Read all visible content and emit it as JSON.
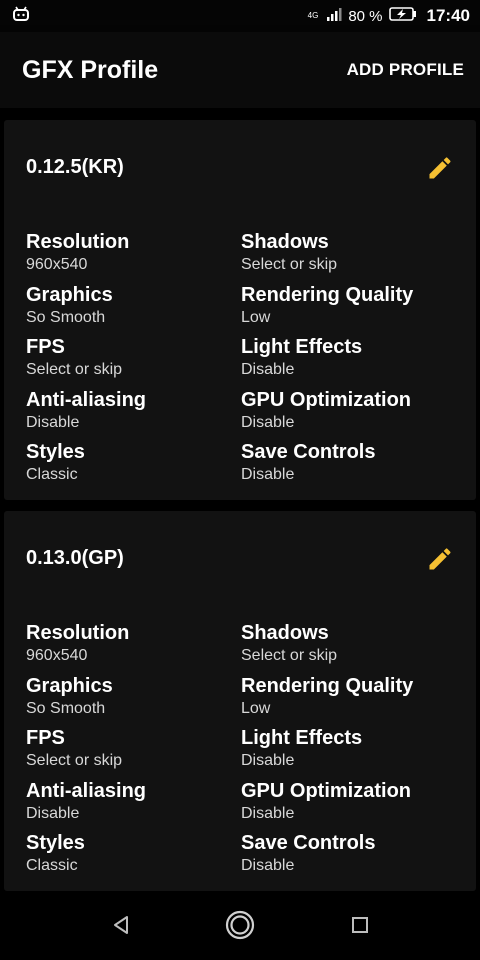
{
  "status_bar": {
    "network": "4G",
    "battery": "80 %",
    "time": "17:40"
  },
  "app_bar": {
    "title": "GFX Profile",
    "action": "ADD PROFILE"
  },
  "colors": {
    "accent": "#f5c032",
    "background": "#000000",
    "card": "#121212"
  },
  "profiles": [
    {
      "name": "0.12.5(KR)",
      "settings": [
        {
          "label": "Resolution",
          "value": "960x540"
        },
        {
          "label": "Shadows",
          "value": "Select or skip"
        },
        {
          "label": "Graphics",
          "value": "So Smooth"
        },
        {
          "label": "Rendering Quality",
          "value": "Low"
        },
        {
          "label": "FPS",
          "value": "Select or skip"
        },
        {
          "label": "Light Effects",
          "value": "Disable"
        },
        {
          "label": "Anti-aliasing",
          "value": "Disable"
        },
        {
          "label": "GPU Optimization",
          "value": "Disable"
        },
        {
          "label": "Styles",
          "value": "Classic"
        },
        {
          "label": "Save Controls",
          "value": "Disable"
        }
      ]
    },
    {
      "name": "0.13.0(GP)",
      "settings": [
        {
          "label": "Resolution",
          "value": "960x540"
        },
        {
          "label": "Shadows",
          "value": "Select or skip"
        },
        {
          "label": "Graphics",
          "value": "So Smooth"
        },
        {
          "label": "Rendering Quality",
          "value": "Low"
        },
        {
          "label": "FPS",
          "value": "Select or skip"
        },
        {
          "label": "Light Effects",
          "value": "Disable"
        },
        {
          "label": "Anti-aliasing",
          "value": "Disable"
        },
        {
          "label": "GPU Optimization",
          "value": "Disable"
        },
        {
          "label": "Styles",
          "value": "Classic"
        },
        {
          "label": "Save Controls",
          "value": "Disable"
        }
      ]
    }
  ],
  "icons": {
    "status_left": "android-debug-icon",
    "edit": "pencil-icon",
    "nav_back": "back-triangle-icon",
    "nav_home": "home-circle-icon",
    "nav_recents": "recents-square-icon"
  }
}
